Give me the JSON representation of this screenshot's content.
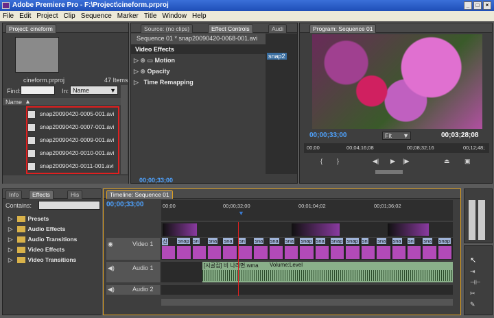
{
  "window": {
    "title": "Adobe Premiere Pro - F:\\Project\\cineform.prproj",
    "buttons": [
      "_",
      "□",
      "×"
    ]
  },
  "menu": [
    "File",
    "Edit",
    "Project",
    "Clip",
    "Sequence",
    "Marker",
    "Title",
    "Window",
    "Help"
  ],
  "project": {
    "tab": "Project: cineform",
    "filename": "cineform.prproj",
    "count": "47 Items",
    "find_label": "Find:",
    "in_label": "In:",
    "in_value": "Name",
    "column": "Name",
    "files": [
      "snap20090420-0005-001.avi",
      "snap20090420-0007-001.avi",
      "snap20090420-0009-001.avi",
      "snap20090420-0010-001.avi",
      "snap20090420-0011-001.avi"
    ]
  },
  "source": {
    "tabs": [
      "Source: (no clips)",
      "Effect Controls",
      "Audi"
    ],
    "sequence_label": "Sequence 01 * snap20090420-0068-001.avi",
    "section": "Video Effects",
    "effects": [
      "Motion",
      "Opacity",
      "Time Remapping"
    ],
    "clip_label": "snap2",
    "timecode": "00;00;33;00"
  },
  "program": {
    "tab": "Program: Sequence 01",
    "timecode": "00;00;33;00",
    "fit": "Fit",
    "duration": "00;03;28;08",
    "ruler": [
      "00;00",
      "00;04;16;08",
      "00;08;32;16",
      "00;12;48;"
    ]
  },
  "effects_panel": {
    "tabs": [
      "Info",
      "Effects",
      "His"
    ],
    "contains_label": "Contains:",
    "items": [
      "Presets",
      "Audio Effects",
      "Audio Transitions",
      "Video Effects",
      "Video Transitions"
    ]
  },
  "timeline": {
    "tab": "Timeline: Sequence 01",
    "timecode": "00;00;33;00",
    "ruler": [
      "00;00",
      "00;00;32;00",
      "00;01;04;02",
      "00;01;36;02"
    ],
    "tracks": {
      "video": "Video 1",
      "audio1": "Audio 1",
      "audio2": "Audio 2"
    },
    "audio_clip": "[시골집] 비 나리면.wma",
    "volume": "Volume:Level",
    "clip_labels": [
      "신",
      "snap",
      "sn",
      "sna",
      "sna",
      "sn",
      "sna",
      "sna",
      "sna",
      "snap",
      "sna",
      "snap",
      "snap",
      "sn",
      "sna",
      "sna",
      "sn",
      "sna",
      "snap"
    ]
  },
  "colors": {
    "highlight": "#e0a020",
    "timecode": "#4fa3ff",
    "selection": "#e02020"
  }
}
